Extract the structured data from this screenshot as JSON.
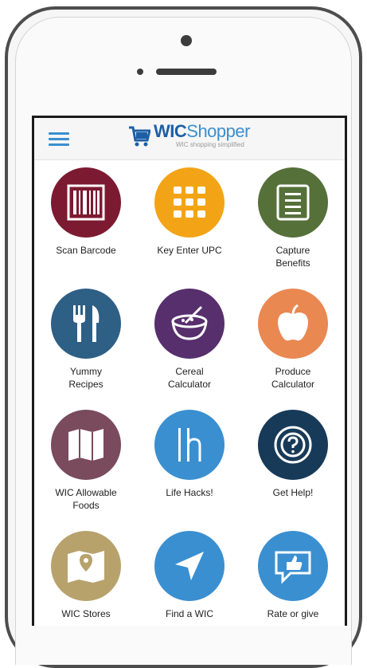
{
  "app": {
    "brand_wic": "WIC",
    "brand_shopper": "Shopper",
    "tagline": "WIC shopping simplified"
  },
  "colors": {
    "wic_blue": "#1c5fa6",
    "accent_blue": "#3a8fd0"
  },
  "tiles": [
    {
      "label": "Scan Barcode",
      "icon": "barcode-icon",
      "color": "#7c1a31"
    },
    {
      "label": "Key Enter UPC",
      "icon": "keypad-icon",
      "color": "#f3a416"
    },
    {
      "label": "Capture\nBenefits",
      "icon": "document-icon",
      "color": "#56703a"
    },
    {
      "label": "Yummy\nRecipes",
      "icon": "utensils-icon",
      "color": "#2e5f85"
    },
    {
      "label": "Cereal\nCalculator",
      "icon": "cereal-bowl-icon",
      "color": "#572f6d"
    },
    {
      "label": "Produce\nCalculator",
      "icon": "apple-icon",
      "color": "#ea8852"
    },
    {
      "label": "WIC Allowable\nFoods",
      "icon": "map-book-icon",
      "color": "#7a4a5d"
    },
    {
      "label": "Life Hacks!",
      "icon": "life-hacks-icon",
      "color": "#3a8fd0"
    },
    {
      "label": "Get Help!",
      "icon": "help-icon",
      "color": "#173a58"
    },
    {
      "label": "WIC Stores",
      "icon": "store-map-icon",
      "color": "#b8a26c"
    },
    {
      "label": "Find a WIC",
      "icon": "navigation-icon",
      "color": "#3a8fd0"
    },
    {
      "label": "Rate or give",
      "icon": "feedback-icon",
      "color": "#3a8fd0"
    }
  ]
}
